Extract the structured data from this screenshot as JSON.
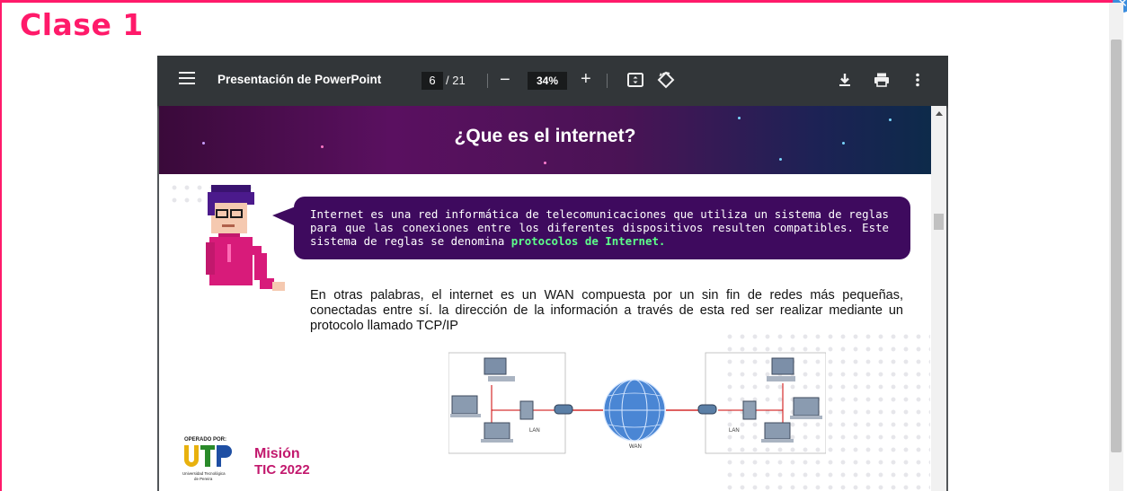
{
  "page": {
    "title": "Clase 1"
  },
  "toolbar": {
    "doc_title": "Presentación de PowerPoint",
    "current_page": "6",
    "total_pages": "/ 21",
    "zoom": "34%",
    "minus": "−",
    "plus": "+"
  },
  "slide": {
    "title": "¿Que es el internet?",
    "bubble_text": "Internet es una red informática de telecomunicaciones que utiliza un sistema de reglas para que las conexiones entre los diferentes dispositivos resulten compatibles. Este sistema de reglas se denomina ",
    "bubble_highlight": "protocolos de Internet.",
    "body_text": "En otras palabras, el internet es un WAN  compuesta por un sin fin de redes más pequeñas, conectadas entre sí.  la dirección de la información a través de esta red ser realizar mediante un protocolo llamado TCP/IP",
    "diagram_labels": {
      "lan_left": "LAN",
      "wan": "WAN",
      "lan_right": "LAN"
    },
    "logo_utp": {
      "operado": "OPERADO POR:",
      "utp": "UTP",
      "name1": "Universidad Tecnológica",
      "name2": "de Pereira"
    },
    "logo_mision": {
      "line1": "Misión",
      "line2": "TIC 2022"
    }
  },
  "colors": {
    "accent": "#ff1a6a",
    "toolbar": "#323639",
    "bubble": "#3e0a5e",
    "highlight": "#5dff8a"
  }
}
